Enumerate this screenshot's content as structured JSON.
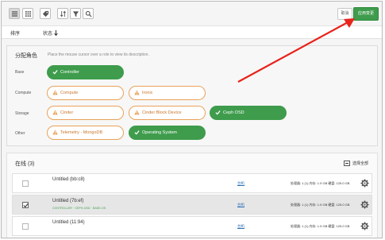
{
  "toolbar": {
    "cancel_label": "取消",
    "save_label": "应用变更",
    "icons": [
      "list-view-icon",
      "grid-view-icon",
      "tag-icon",
      "sort-icon",
      "filter-icon",
      "search-icon"
    ]
  },
  "sortbar": {
    "col1": "排序",
    "col2": "状态",
    "sort_arrow": "down-arrow-icon"
  },
  "roles_panel": {
    "title": "分配角色",
    "hint": "Place the mouse cursor over a role to view its description.",
    "groups": [
      {
        "label": "Base",
        "roles": [
          {
            "name": "Controller",
            "state": "selected"
          }
        ]
      },
      {
        "label": "Compute",
        "roles": [
          {
            "name": "Compute",
            "state": "warning"
          },
          {
            "name": "Ironic",
            "state": "warning"
          }
        ]
      },
      {
        "label": "Storage",
        "roles": [
          {
            "name": "Cinder",
            "state": "warning"
          },
          {
            "name": "Cinder Block Device",
            "state": "warning"
          },
          {
            "name": "Ceph OSD",
            "state": "selected"
          }
        ]
      },
      {
        "label": "Other",
        "roles": [
          {
            "name": "Telemetry - MongoDB",
            "state": "warning"
          },
          {
            "name": "Operating System",
            "state": "selected"
          }
        ]
      }
    ]
  },
  "nodes": {
    "title": "在线 (3)",
    "select_all_label": "选择全部",
    "items": [
      {
        "name": "Untitled (bb:c8)",
        "roles": "",
        "selected": false,
        "link": "台机",
        "spec": "处理器: 1 (1) 内存: 1.9 GB 硬盘: 125.0 GB"
      },
      {
        "name": "Untitled (7b:ef)",
        "roles": "CONTROLLER · CEPH-OSD · BASE-OS",
        "selected": true,
        "link": "台机",
        "spec": "处理器: 1 (1) 内存: 1.9 GB 硬盘: 125.0 GB"
      },
      {
        "name": "Untitled (11:94)",
        "roles": "",
        "selected": false,
        "link": "台机",
        "spec": "处理器: 1 (1) 内存: 1.9 GB 硬盘: 125.0 GB"
      }
    ]
  },
  "colors": {
    "selected_green": "#3e9c4c",
    "warning_orange": "#e9a25b",
    "annotation_red": "#e8231b"
  }
}
